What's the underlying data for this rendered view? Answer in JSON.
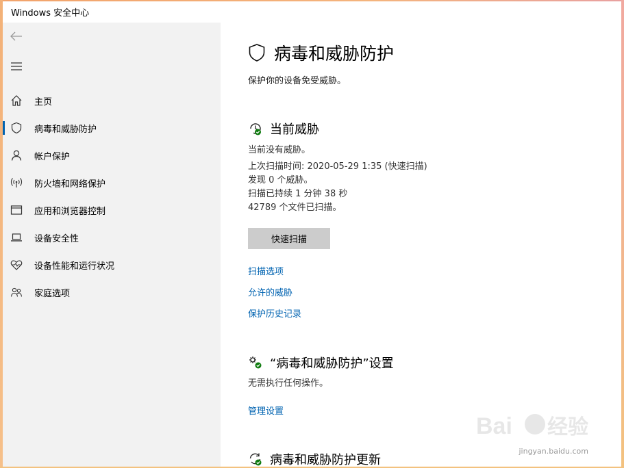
{
  "window": {
    "title": "Windows 安全中心"
  },
  "sidebar": {
    "items": [
      {
        "label": "主页",
        "icon": "home-icon"
      },
      {
        "label": "病毒和威胁防护",
        "icon": "shield-icon",
        "active": true
      },
      {
        "label": "帐户保护",
        "icon": "person-icon"
      },
      {
        "label": "防火墙和网络保护",
        "icon": "wifi-antenna-icon"
      },
      {
        "label": "应用和浏览器控制",
        "icon": "app-window-icon"
      },
      {
        "label": "设备安全性",
        "icon": "laptop-icon"
      },
      {
        "label": "设备性能和运行状况",
        "icon": "heart-pulse-icon"
      },
      {
        "label": "家庭选项",
        "icon": "family-icon"
      }
    ]
  },
  "main": {
    "title": "病毒和威胁防护",
    "subtitle": "保护你的设备免受威胁。",
    "current_threats": {
      "title": "当前威胁",
      "no_threats": "当前没有威胁。",
      "last_scan": "上次扫描时间: 2020-05-29 1:35 (快速扫描)",
      "found": "发现 0 个威胁。",
      "duration": "扫描已持续 1 分钟 38 秒",
      "files": "42789 个文件已扫描。",
      "scan_button": "快速扫描",
      "links": [
        "扫描选项",
        "允许的威胁",
        "保护历史记录"
      ]
    },
    "settings": {
      "title": "“病毒和威胁防护”设置",
      "status": "无需执行任何操作。",
      "link": "管理设置"
    },
    "updates": {
      "title": "病毒和威胁防护更新"
    }
  },
  "watermark": {
    "url": "jingyan.baidu.com"
  },
  "colors": {
    "accent": "#0063b1",
    "sidebar_bg": "#f2f2f2",
    "status_ok": "#107c10",
    "button_bg": "#cccccc"
  }
}
